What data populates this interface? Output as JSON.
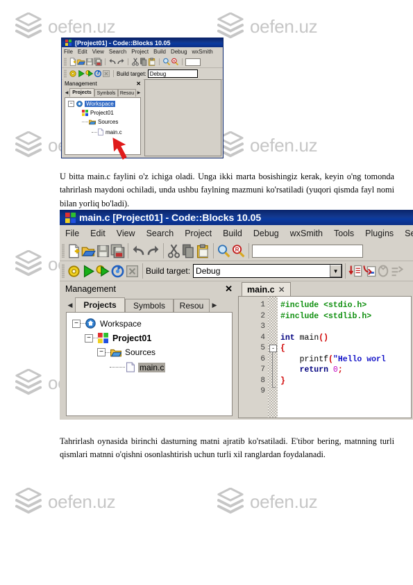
{
  "watermark": {
    "text": "oefen.uz",
    "logo_icon": "stacked-layers-logo"
  },
  "paragraphs": {
    "upper": "U  bitta  main.c  faylini  o'z  ichiga  oladi.  Unga  ikki  marta  bosishingiz  kerak,  keyin o'ng   tomonda   tahrirlash   maydoni   ochiladi,   unda   ushbu   faylning   mazmuni ko'rsatiladi (yuqori qismda fayl nomi bilan yorliq bo'ladi).",
    "lower": "Tahrirlash  oynasida  birinchi  dasturning  matni  ajratib  ko'rsatiladi.  E'tibor  bering, matnning  turli  qismlari  matnni  o'qishni  osonlashtirish  uchun  turli  xil  ranglardan foydalanadi."
  },
  "window_small": {
    "title": "[Project01] - Code::Blocks 10.05",
    "menu": [
      "File",
      "Edit",
      "View",
      "Search",
      "Project",
      "Build",
      "Debug",
      "wxSmith"
    ],
    "toolbar_icons": [
      "new-file-icon",
      "open-file-icon",
      "save-icon",
      "save-all-icon",
      "undo-icon",
      "redo-icon",
      "cut-icon",
      "copy-icon",
      "paste-icon",
      "find-icon",
      "replace-icon"
    ],
    "build_toolbar_icons": [
      "build-icon",
      "run-icon",
      "build-and-run-icon",
      "rebuild-icon",
      "abort-icon"
    ],
    "build_target_label": "Build target:",
    "build_target_value": "Debug",
    "management": {
      "title": "Management",
      "close_icon": "close-icon",
      "tabs": [
        "Projects",
        "Symbols",
        "Resou"
      ],
      "active_tab": "Projects",
      "tree": [
        {
          "label": "Workspace",
          "icon": "workspace-icon",
          "selected": true
        },
        {
          "label": "Project01",
          "icon": "project-icon",
          "bold": true
        },
        {
          "label": "Sources",
          "icon": "folder-icon"
        },
        {
          "label": "main.c",
          "icon": "file-icon"
        }
      ]
    },
    "annotation_icon": "red-arrow-pointer"
  },
  "window_large": {
    "title": "main.c [Project01] - Code::Blocks 10.05",
    "menu": [
      "File",
      "Edit",
      "View",
      "Search",
      "Project",
      "Build",
      "Debug",
      "wxSmith",
      "Tools",
      "Plugins",
      "Settings"
    ],
    "toolbar_icons": [
      "new-file-icon",
      "open-file-icon",
      "save-icon",
      "save-all-icon",
      "undo-icon",
      "redo-icon",
      "cut-icon",
      "copy-icon",
      "paste-icon",
      "find-icon",
      "replace-icon"
    ],
    "build_toolbar_icons": [
      "build-icon",
      "run-icon",
      "build-and-run-icon",
      "rebuild-icon",
      "abort-icon"
    ],
    "debug_toolbar_icons": [
      "debug-continue-icon",
      "debug-next-line-icon",
      "debug-step-into-icon",
      "debug-step-out-icon"
    ],
    "build_target_label": "Build target:",
    "build_target_value": "Debug",
    "search_field_value": "",
    "management": {
      "title": "Management",
      "close_icon": "close-icon",
      "tabs": [
        "Projects",
        "Symbols",
        "Resou"
      ],
      "active_tab": "Projects",
      "tree": [
        {
          "label": "Workspace",
          "icon": "workspace-icon"
        },
        {
          "label": "Project01",
          "icon": "project-icon",
          "bold": true
        },
        {
          "label": "Sources",
          "icon": "folder-icon"
        },
        {
          "label": "main.c",
          "icon": "file-icon",
          "selected": true
        }
      ]
    },
    "editor": {
      "tab_label": "main.c",
      "tab_close_icon": "close-icon",
      "line_numbers": [
        "1",
        "2",
        "3",
        "4",
        "5",
        "6",
        "7",
        "8",
        "9"
      ],
      "code_lines": [
        {
          "n": "1",
          "tokens": [
            {
              "t": "#include <stdio.h>",
              "c": "pre"
            }
          ]
        },
        {
          "n": "2",
          "tokens": [
            {
              "t": "#include <stdlib.h>",
              "c": "pre"
            }
          ]
        },
        {
          "n": "3",
          "tokens": []
        },
        {
          "n": "4",
          "tokens": [
            {
              "t": "int",
              "c": "kw"
            },
            {
              "t": " main",
              "c": "fn"
            },
            {
              "t": "()",
              "c": "op"
            }
          ]
        },
        {
          "n": "5",
          "tokens": [
            {
              "t": "{",
              "c": "op"
            }
          ]
        },
        {
          "n": "6",
          "tokens": [
            {
              "t": "    printf",
              "c": "fn"
            },
            {
              "t": "(",
              "c": "op"
            },
            {
              "t": "\"Hello worl",
              "c": "str"
            }
          ]
        },
        {
          "n": "7",
          "tokens": [
            {
              "t": "    return",
              "c": "kw"
            },
            {
              "t": " 0",
              "c": "num"
            },
            {
              "t": ";",
              "c": "op"
            }
          ]
        },
        {
          "n": "8",
          "tokens": [
            {
              "t": "}",
              "c": "op"
            }
          ]
        },
        {
          "n": "9",
          "tokens": []
        }
      ],
      "fold_marker": "-"
    }
  },
  "colors": {
    "titlebar_blue": "#0a246a",
    "chrome_gray": "#d4d0c8",
    "preprocessor_green": "#109010",
    "keyword_navy": "#00007f",
    "string_blue": "#1515c8",
    "number_magenta": "#c000c0",
    "operator_red": "#d00000",
    "selection_blue": "#316ac5",
    "watermark_gray": "#c6c6c6",
    "annotation_red": "#e01b1b"
  }
}
